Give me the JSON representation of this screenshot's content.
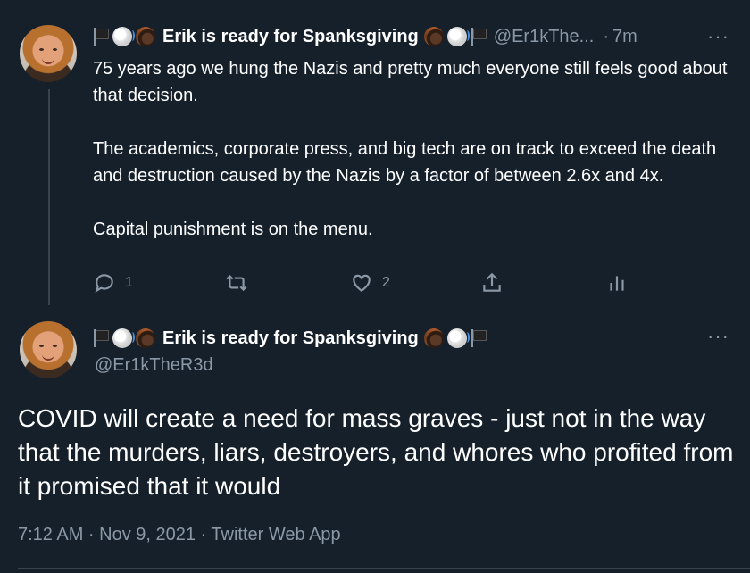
{
  "tweet1": {
    "display_name": "Erik is ready for Spanksgiving",
    "handle": "@Er1kThe...",
    "separator": "·",
    "time": "7m",
    "more": "···",
    "paragraphs": [
      "75 years ago we hung the Nazis and pretty much everyone still feels good about that decision.",
      "The academics, corporate press, and big tech are on track to exceed the death and destruction caused by the Nazis by a factor of between 2.6x and 4x.",
      "Capital punishment is on the menu."
    ],
    "actions": {
      "reply_count": "1",
      "retweet_count": "",
      "like_count": "2"
    },
    "icons": [
      "reply-icon",
      "retweet-icon",
      "like-icon",
      "share-icon",
      "analytics-icon"
    ]
  },
  "tweet2": {
    "display_name": "Erik is ready for Spanksgiving",
    "handle": "@Er1kTheR3d",
    "more": "···",
    "text": "COVID will create a need for mass graves - just not in the way that the murders, liars, destroyers, and whores who profited from it promised that it would",
    "timestamp": "7:12 AM · Nov 9, 2021 · Twitter Web App"
  },
  "colors": {
    "background": "#15202b",
    "text": "#ffffff",
    "muted": "#8b98a5",
    "divider": "#38444d"
  }
}
